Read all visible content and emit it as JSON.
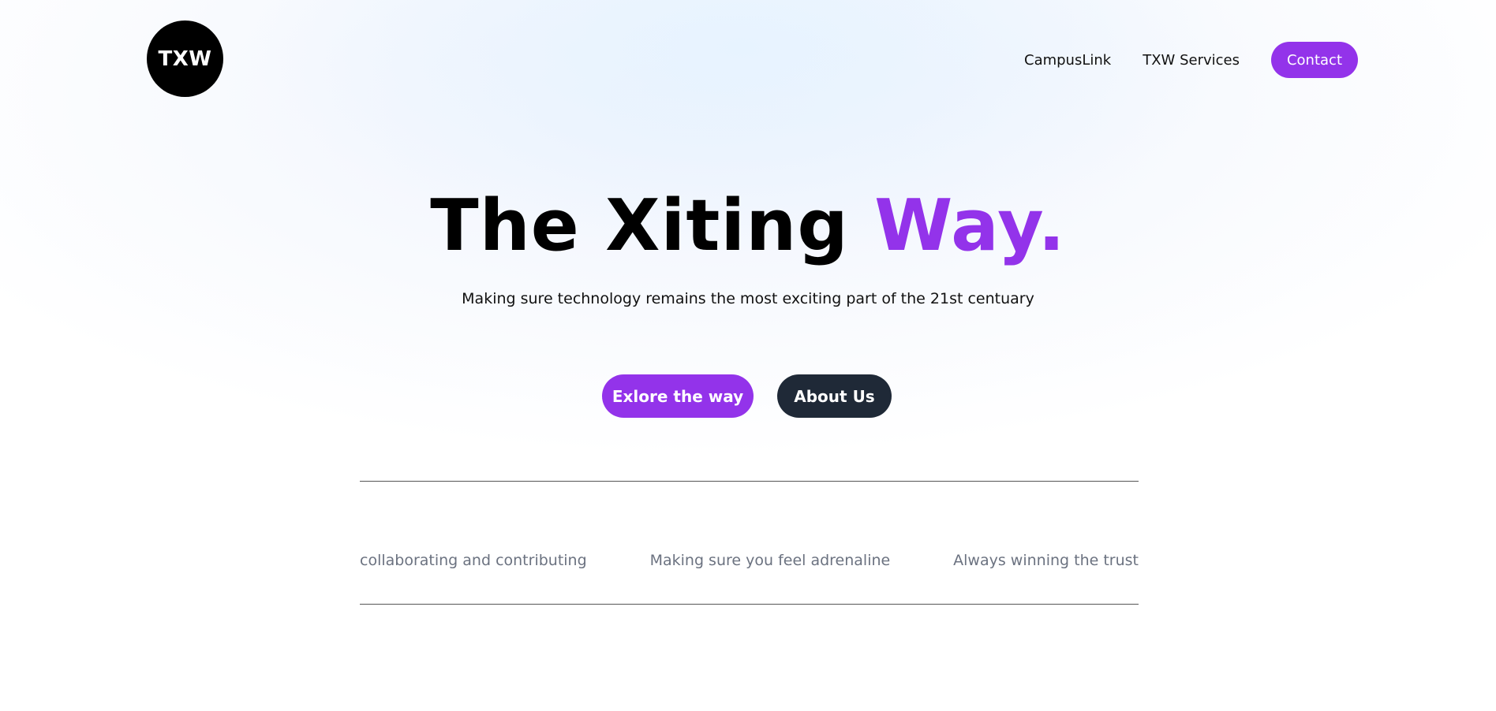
{
  "logo": {
    "text": "TXW"
  },
  "nav": {
    "links": [
      "CampusLink",
      "TXW Services"
    ],
    "contact_label": "Contact"
  },
  "hero": {
    "title_main": "The Xiting ",
    "title_accent": "Way.",
    "subtitle": "Making sure technology remains the most exciting part of the 21st centuary"
  },
  "cta": {
    "primary_label": "Exlore the way",
    "secondary_label": "About Us"
  },
  "values": [
    "collaborating and contributing",
    "Making sure you feel adrenaline",
    "Always winning the trust"
  ],
  "colors": {
    "accent": "#9333ea",
    "dark_button": "#1f2937",
    "muted_text": "#6b7280"
  }
}
